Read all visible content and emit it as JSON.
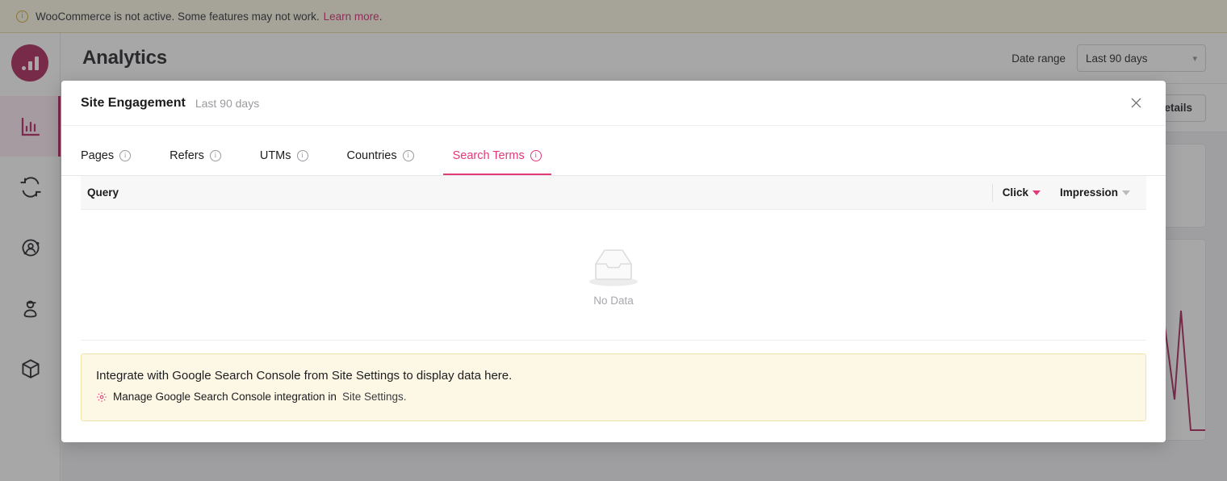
{
  "banner": {
    "icon": "info-circle-icon",
    "text": "WooCommerce is not active. Some features may not work.",
    "link": "Learn more",
    "period": ".",
    "accent": "#d5226c",
    "background": "#fdf8e3"
  },
  "sidebar": {
    "logo_name": "bar-chart-logo",
    "items": [
      {
        "name": "sidebar-item-analytics",
        "icon": "bar-chart-icon",
        "active": true
      },
      {
        "name": "sidebar-item-sync",
        "icon": "refresh-sync-icon",
        "active": false
      },
      {
        "name": "sidebar-item-audience",
        "icon": "user-circle-icon",
        "active": false
      },
      {
        "name": "sidebar-item-visitors",
        "icon": "person-cap-icon",
        "active": false
      },
      {
        "name": "sidebar-item-products",
        "icon": "cube-icon",
        "active": false
      }
    ]
  },
  "header": {
    "title": "Analytics",
    "date_range_label": "Date range",
    "date_range_value": "Last 90 days",
    "chevron": "chevron-down-icon",
    "details_button": "Details"
  },
  "modal": {
    "title": "Site Engagement",
    "subtitle": "Last 90 days",
    "close_icon": "close-icon",
    "tabs": [
      {
        "label": "Pages",
        "info": "info-icon",
        "active": false
      },
      {
        "label": "Refers",
        "info": "info-icon",
        "active": false
      },
      {
        "label": "UTMs",
        "info": "info-icon",
        "active": false
      },
      {
        "label": "Countries",
        "info": "info-icon",
        "active": false
      },
      {
        "label": "Search Terms",
        "info": "info-icon",
        "active": true
      }
    ],
    "table": {
      "col_query": "Query",
      "col_click": "Click",
      "col_impression": "Impression",
      "click_sort": "sort-caret-active",
      "impression_sort": "sort-caret-inactive",
      "empty_icon": "empty-tray-icon",
      "empty_label": "No Data",
      "rows": []
    },
    "notice": {
      "title": "Integrate with Google Search Console from Site Settings to display data here.",
      "gear_icon": "gear-icon",
      "link_strong": "Manage Google Search Console integration in",
      "link_tail": "Site Settings.",
      "background": "#fdf8e6",
      "border": "#f0e3a8"
    }
  },
  "colors": {
    "accent_pink": "#e03a78",
    "brand_pink": "#a81e52",
    "scrim": "rgba(60,60,62,0.45)"
  }
}
